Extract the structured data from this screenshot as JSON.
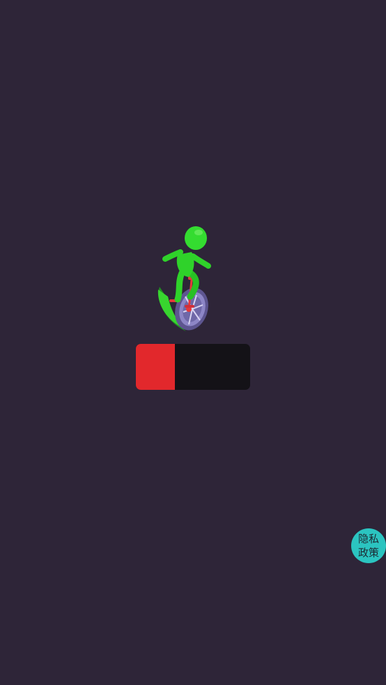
{
  "game": {
    "background_color": "#2e2538",
    "character": {
      "description_icon": "unicycle-rider-icon",
      "body_color": "#2fd22a",
      "wheel_color": "#7f77b8",
      "seat_color": "#e5383a"
    },
    "progress": {
      "value_fraction": 0.34,
      "fill_color": "#e2282c",
      "track_color": "#141217"
    }
  },
  "privacy_button": {
    "line1": "隐私",
    "line2": "政策",
    "color": "#2bc4c0"
  }
}
